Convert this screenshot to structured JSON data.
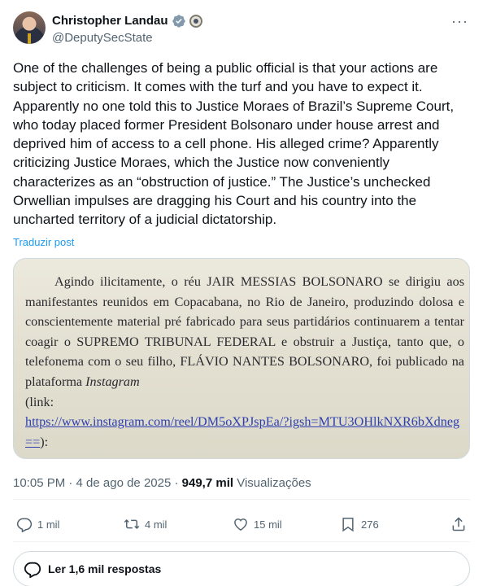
{
  "author": {
    "name": "Christopher Landau",
    "handle": "@DeputySecState"
  },
  "tweet": {
    "text": "One of the challenges of being a public official is that your actions are subject to criticism. It comes with the turf and you have to expect it. Apparently no one told this to Justice Moraes of Brazil’s Supreme Court, who today placed former President Bolsonaro under house arrest and deprived him of access to a cell phone. His alleged crime? Apparently criticizing Justice Moraes, which the Justice now conveniently characterizes as an “obstruction of justice.”  The Justice’s unchecked Orwellian impulses are dragging his Court and his country into the uncharted territory of a judicial dictatorship.",
    "translate_label": "Traduzir post"
  },
  "media": {
    "text_main": "Agindo ilicitamente, o réu JAIR MESSIAS BOLSONARO se dirigiu aos manifestantes reunidos em Copacabana, no Rio de Janeiro, produzindo dolosa e conscientemente material pré fabricado para seus partidários continuarem a tentar coagir o SUPREMO TRIBUNAL FEDERAL e obstruir a Justiça, tanto que, o telefonema com o seu filho, FLÁVIO NANTES BOLSONARO, foi publicado na plataforma",
    "text_italic": "Instagram",
    "text_link_prefix": "(link:",
    "link": "https://www.instagram.com/reel/DM5oXPJspEa/?igsh=MTU3OHlkNXR6bXdneg==",
    "text_link_suffix": "):"
  },
  "meta": {
    "time_date": "10:05 PM · 4 de ago de 2025 · ",
    "views_count": "949,7 mil",
    "views_label": " Visualizações"
  },
  "actions": {
    "replies": "1 mil",
    "reposts": "4 mil",
    "likes": "15 mil",
    "bookmarks": "276"
  },
  "read_replies_label": "Ler 1,6 mil respostas",
  "colors": {
    "accent": "#1d9bf0",
    "muted": "#536471",
    "text": "#0f1419"
  }
}
